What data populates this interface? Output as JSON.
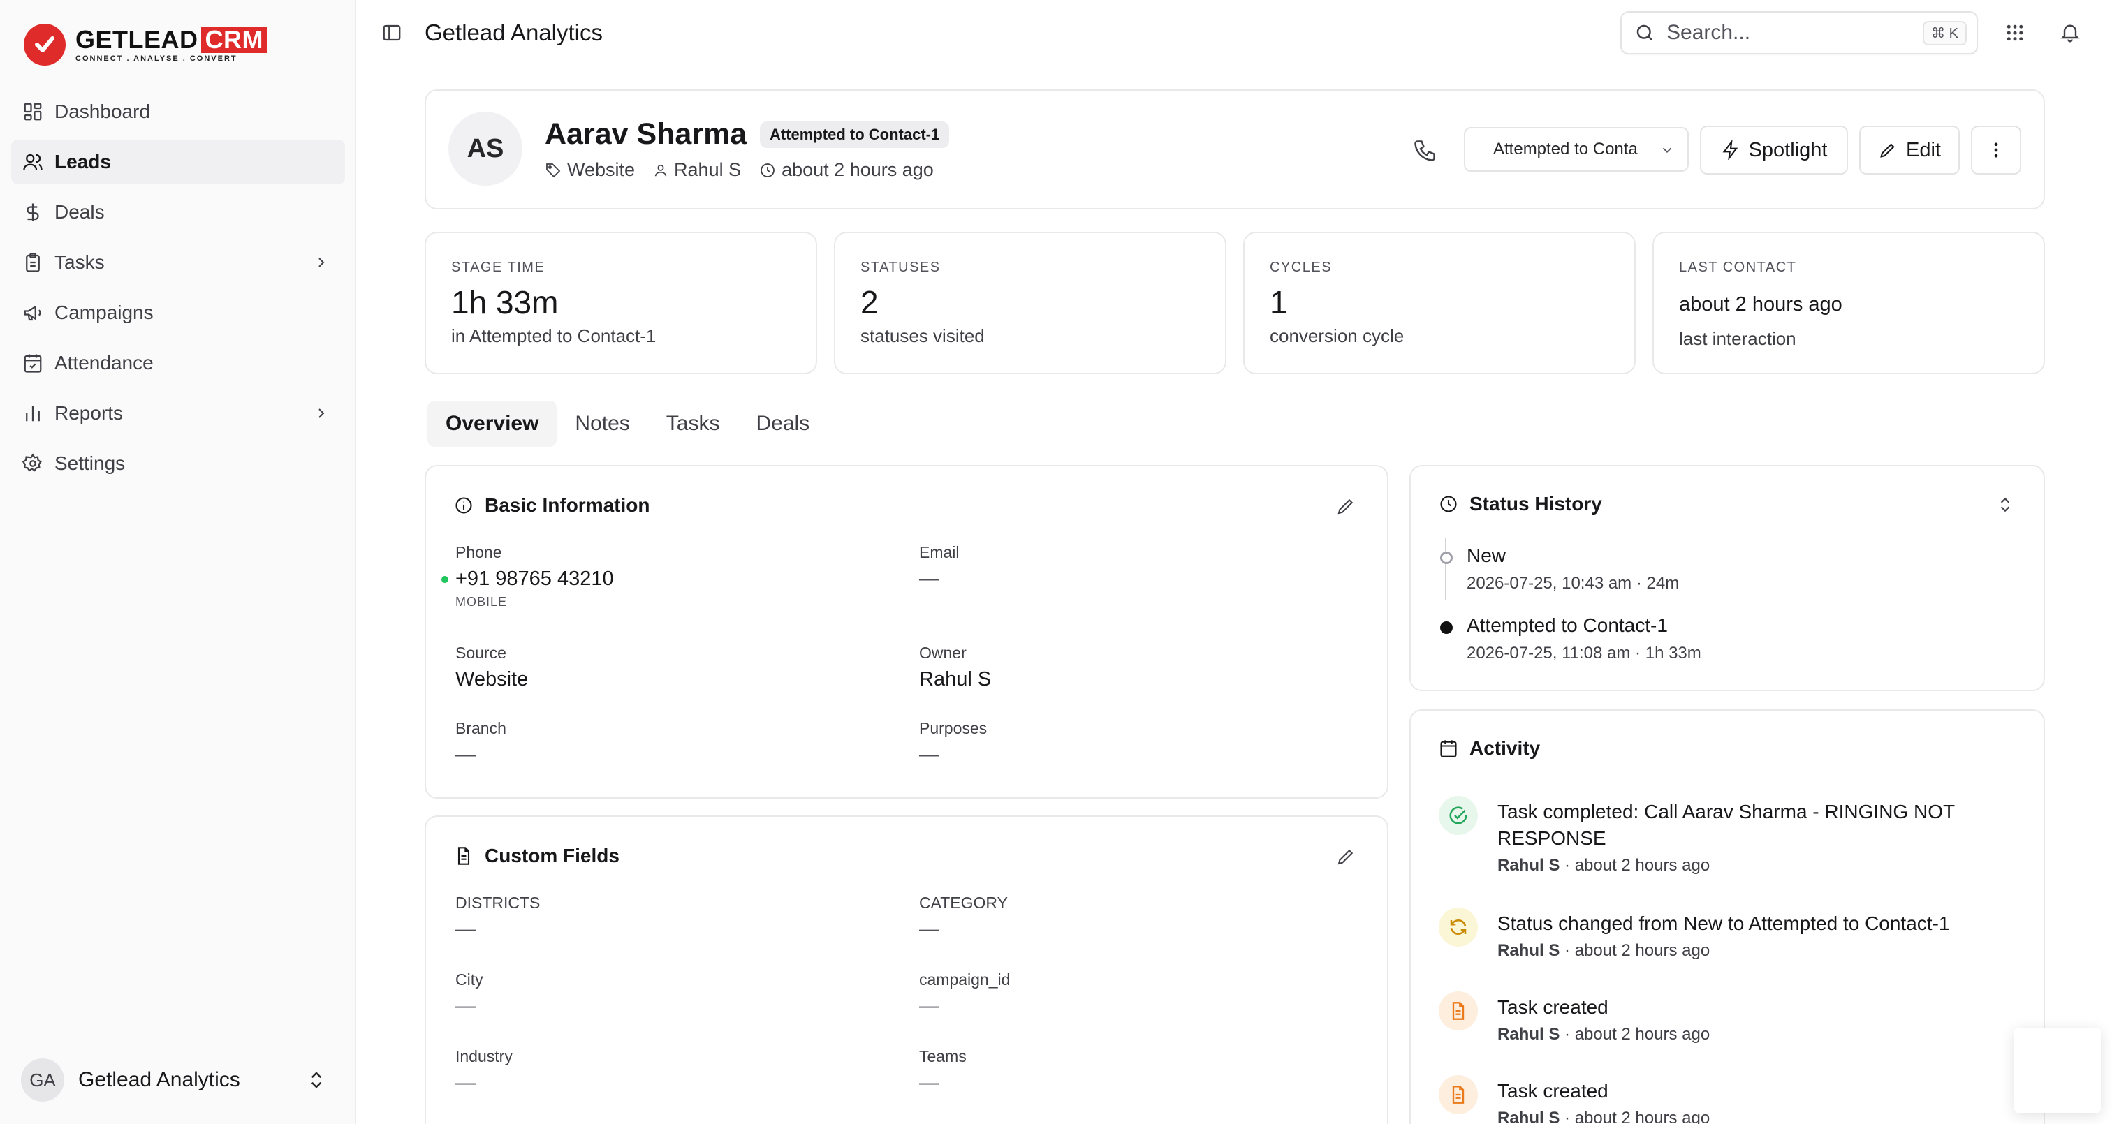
{
  "brand": {
    "name": "GETLEAD",
    "suffix": "CRM",
    "tagline": "CONNECT  .  ANALYSE  .  CONVERT",
    "accent": "#e02b2b"
  },
  "sidebar": {
    "items": [
      {
        "label": "Dashboard",
        "icon": "dashboard-icon"
      },
      {
        "label": "Leads",
        "icon": "users-icon",
        "active": true
      },
      {
        "label": "Deals",
        "icon": "dollar-icon"
      },
      {
        "label": "Tasks",
        "icon": "clipboard-icon",
        "has_children": true
      },
      {
        "label": "Campaigns",
        "icon": "megaphone-icon"
      },
      {
        "label": "Attendance",
        "icon": "calendar-check-icon"
      },
      {
        "label": "Reports",
        "icon": "bar-chart-icon",
        "has_children": true
      },
      {
        "label": "Settings",
        "icon": "gear-icon"
      }
    ],
    "workspace": {
      "initials": "GA",
      "name": "Getlead Analytics"
    }
  },
  "topbar": {
    "title": "Getlead Analytics",
    "search_placeholder": "Search...",
    "search_shortcut": "⌘ K"
  },
  "lead": {
    "initials": "AS",
    "name": "Aarav Sharma",
    "status": "Attempted to Contact-1",
    "source": "Website",
    "owner": "Rahul S",
    "created": "about 2 hours ago",
    "status_select": "Attempted to Conta",
    "actions": {
      "spotlight": "Spotlight",
      "edit": "Edit"
    }
  },
  "stats": [
    {
      "label": "STAGE TIME",
      "value": "1h 33m",
      "sub": "in Attempted to Contact-1"
    },
    {
      "label": "STATUSES",
      "value": "2",
      "sub": "statuses visited"
    },
    {
      "label": "CYCLES",
      "value": "1",
      "sub": "conversion cycle"
    },
    {
      "label": "LAST CONTACT",
      "value": "about 2 hours ago",
      "sub": "last interaction"
    }
  ],
  "tabs": [
    "Overview",
    "Notes",
    "Tasks",
    "Deals"
  ],
  "basic_info": {
    "title": "Basic Information",
    "phone": {
      "label": "Phone",
      "value": "+91 98765 43210",
      "note": "MOBILE"
    },
    "email": {
      "label": "Email",
      "value": "—"
    },
    "source": {
      "label": "Source",
      "value": "Website"
    },
    "owner": {
      "label": "Owner",
      "value": "Rahul S"
    },
    "branch": {
      "label": "Branch",
      "value": "—"
    },
    "purposes": {
      "label": "Purposes",
      "value": "—"
    }
  },
  "custom_fields": {
    "title": "Custom Fields",
    "fields": [
      {
        "label": "DISTRICTS",
        "value": "—"
      },
      {
        "label": "CATEGORY",
        "value": "—"
      },
      {
        "label": "City",
        "value": "—"
      },
      {
        "label": "campaign_id",
        "value": "—"
      },
      {
        "label": "Industry",
        "value": "—"
      },
      {
        "label": "Teams",
        "value": "—"
      }
    ]
  },
  "status_history": {
    "title": "Status History",
    "entries": [
      {
        "status": "New",
        "meta": "2026-07-25, 10:43 am · 24m"
      },
      {
        "status": "Attempted to Contact-1",
        "meta": "2026-07-25, 11:08 am · 1h 33m"
      }
    ]
  },
  "activity": {
    "title": "Activity",
    "items": [
      {
        "text": "Task completed: Call Aarav Sharma - RINGING NOT RESPONSE",
        "user": "Rahul S",
        "time": "about 2 hours ago",
        "icon": "check-circle-icon"
      },
      {
        "text": "Status changed from New to Attempted to Contact-1",
        "user": "Rahul S",
        "time": "about 2 hours ago",
        "icon": "refresh-icon"
      },
      {
        "text": "Task created",
        "user": "Rahul S",
        "time": "about 2 hours ago",
        "icon": "file-icon"
      },
      {
        "text": "Task created",
        "user": "Rahul S",
        "time": "about 2 hours ago",
        "icon": "file-icon"
      }
    ],
    "separator": "·"
  }
}
